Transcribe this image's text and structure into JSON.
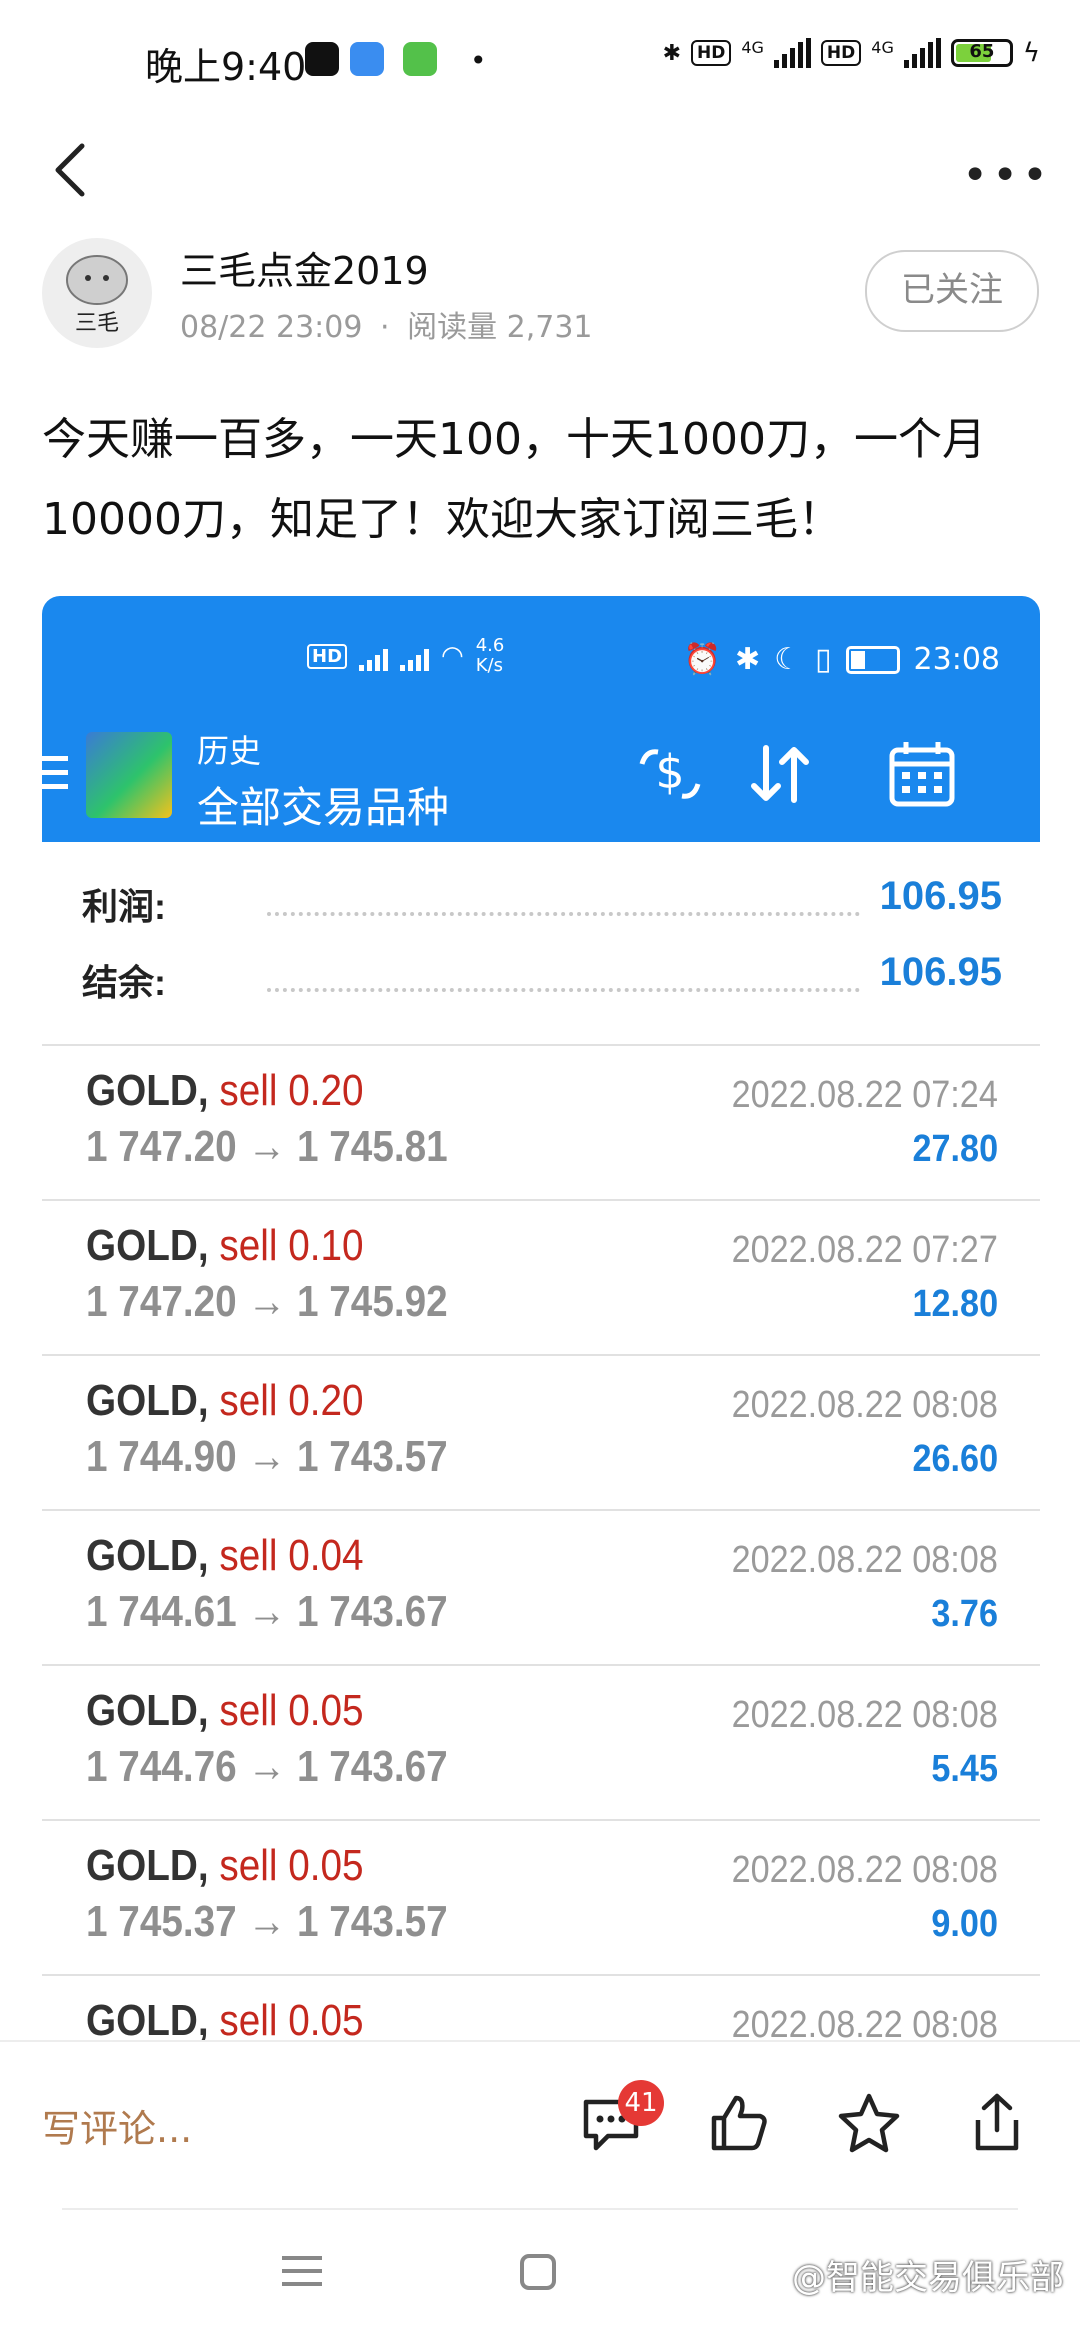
{
  "status_bar": {
    "time": "晚上9:40",
    "battery": "65",
    "network1": "4G",
    "network2": "4G",
    "hd": "HD"
  },
  "nav": {
    "back_icon": "chevron-left-icon",
    "more_icon": "more-dots-icon"
  },
  "author": {
    "name": "三毛点金2019",
    "avatar_text": "三毛",
    "date": "08/22 23:09",
    "reads": "阅读量 2,731",
    "follow_label": "已关注"
  },
  "post": {
    "text": "今天赚一百多，一天100，十天1000刀，一个月10000刀，知足了！欢迎大家订阅三毛！"
  },
  "embedded": {
    "status": {
      "speed": "4.6 K/s",
      "time": "23:08"
    },
    "header": {
      "title": "历史",
      "subtitle": "全部交易品种"
    },
    "summary": [
      {
        "label": "利润:",
        "value": "106.95"
      },
      {
        "label": "结余:",
        "value": "106.95"
      }
    ],
    "trades": [
      {
        "symbol": "GOLD,",
        "side": "sell 0.20",
        "prices": "1 747.20 → 1 745.81",
        "time": "2022.08.22 07:24",
        "profit": "27.80"
      },
      {
        "symbol": "GOLD,",
        "side": "sell 0.10",
        "prices": "1 747.20 → 1 745.92",
        "time": "2022.08.22 07:27",
        "profit": "12.80"
      },
      {
        "symbol": "GOLD,",
        "side": "sell 0.20",
        "prices": "1 744.90 → 1 743.57",
        "time": "2022.08.22 08:08",
        "profit": "26.60"
      },
      {
        "symbol": "GOLD,",
        "side": "sell 0.04",
        "prices": "1 744.61 → 1 743.67",
        "time": "2022.08.22 08:08",
        "profit": "3.76"
      },
      {
        "symbol": "GOLD,",
        "side": "sell 0.05",
        "prices": "1 744.76 → 1 743.67",
        "time": "2022.08.22 08:08",
        "profit": "5.45"
      },
      {
        "symbol": "GOLD,",
        "side": "sell 0.05",
        "prices": "1 745.37 → 1 743.57",
        "time": "2022.08.22 08:08",
        "profit": "9.00"
      },
      {
        "symbol": "GOLD,",
        "side": "sell 0.05",
        "prices": "",
        "time": "2022.08.22 08:08",
        "profit": ""
      }
    ],
    "colors": {
      "header_blue": "#1a88ee",
      "sell_red": "#c4281e",
      "profit_blue": "#1a7fd9"
    }
  },
  "actions": {
    "comment_placeholder": "写评论...",
    "comment_count": "41",
    "icons": [
      "comment-icon",
      "thumbs-up-icon",
      "star-icon",
      "share-icon"
    ]
  },
  "watermark": "@智能交易俱乐部"
}
